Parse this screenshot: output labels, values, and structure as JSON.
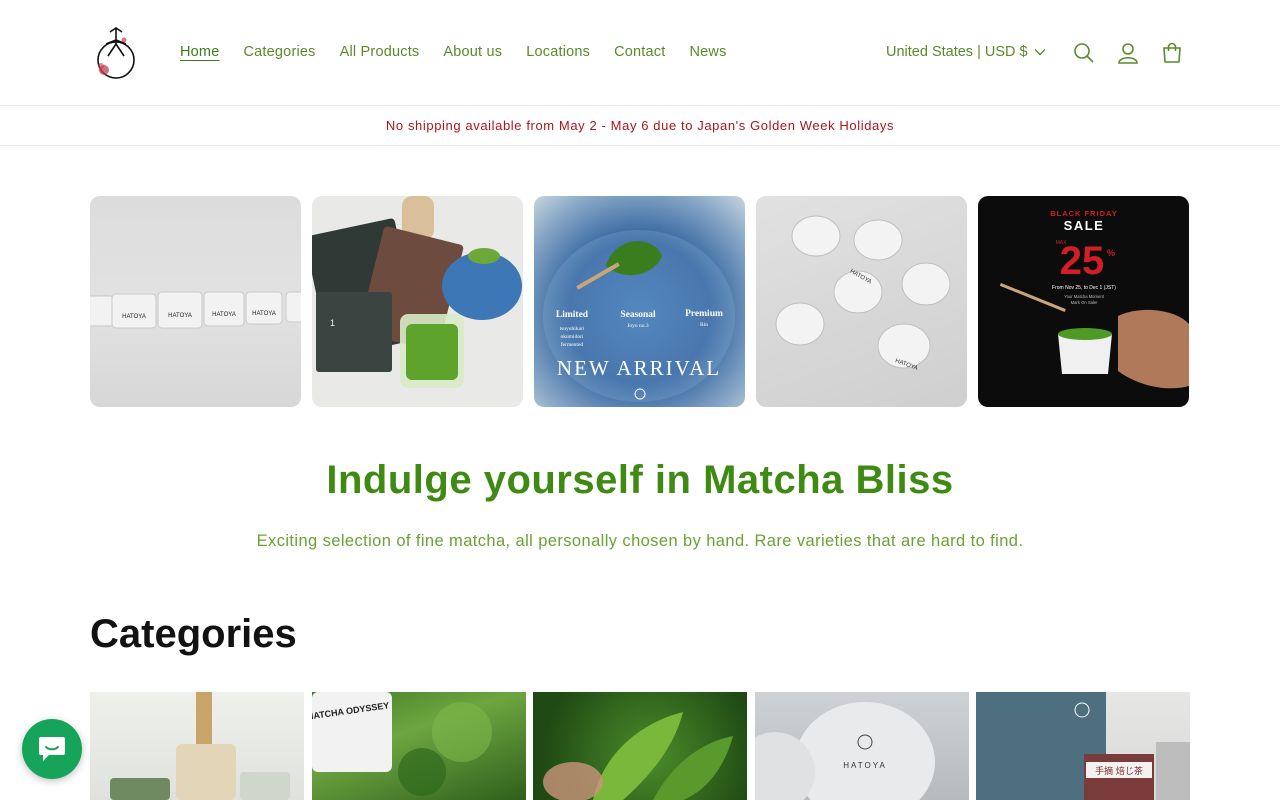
{
  "header": {
    "logo_icon": "hatoya-logo-icon",
    "nav": [
      {
        "label": "Home",
        "active": true
      },
      {
        "label": "Categories"
      },
      {
        "label": "All Products"
      },
      {
        "label": "About us"
      },
      {
        "label": "Locations"
      },
      {
        "label": "Contact"
      },
      {
        "label": "News"
      }
    ],
    "locale_label": "United States | USD $",
    "icons": [
      "search-icon",
      "account-icon",
      "cart-icon"
    ]
  },
  "announcement": {
    "text": "No shipping available from May 2 - May 6 due to Japan's Golden Week Holidays",
    "color": "#b0141a"
  },
  "slides": [
    {
      "tins_label": "HATOYA"
    },
    {
      "packet_number": "1"
    },
    {
      "labels": [
        {
          "title": "Limited",
          "lines": [
            "tsuyuhikari",
            "okumidori",
            "fermented"
          ]
        },
        {
          "title": "Seasonal",
          "lines": [
            "Joyo no.3"
          ]
        },
        {
          "title": "Premium",
          "lines": [
            "Rin"
          ]
        }
      ],
      "banner": "NEW ARRIVAL"
    },
    {
      "tins_label": "HATOYA"
    },
    {
      "kicker": "BLACK FRIDAY",
      "title": "SALE",
      "max_label": "MAX",
      "percent": "25",
      "percent_sign": "%",
      "dates": "From Nov 25, to Dec 1 (JST)",
      "tagline_1": "Your Matcha Moment",
      "tagline_2": "Mark On Sale!"
    }
  ],
  "hero": {
    "title": "Indulge yourself in Matcha Bliss",
    "subtitle": "Exciting selection of fine matcha, all personally chosen by hand. Rare varieties that are hard to find."
  },
  "categories": {
    "title": "Categories",
    "tile_text": {
      "shirt": "MATCHA ODYSSEY",
      "tin": "HATOYA",
      "box_label": "手摘 焙じ茶"
    }
  },
  "chat_icon": "chat-bubble-icon",
  "colors": {
    "nav_green": "#5a8a2a",
    "hero_green": "#3f8a12",
    "subtitle_green": "#6aa234",
    "chat_green": "#16a35a",
    "sale_red": "#d21f26"
  }
}
